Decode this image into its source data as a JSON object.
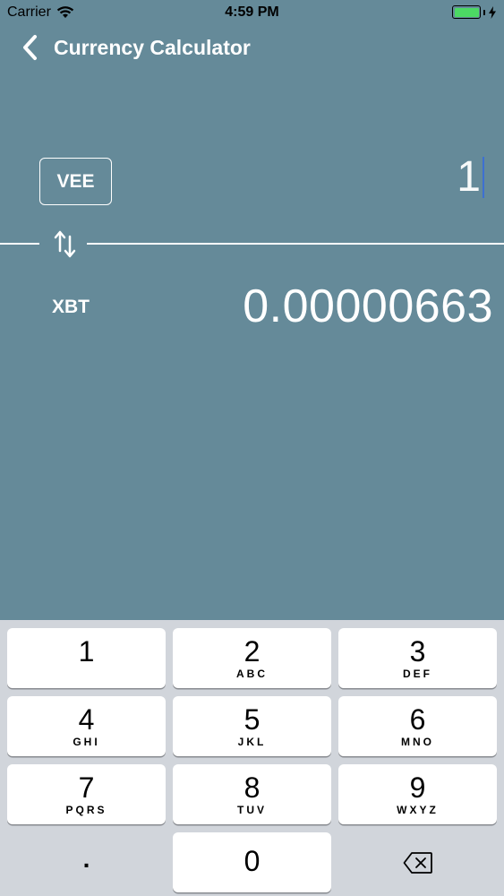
{
  "status_bar": {
    "carrier": "Carrier",
    "time": "4:59 PM",
    "battery_level": 1.0
  },
  "nav": {
    "title": "Currency Calculator"
  },
  "converter": {
    "from_code": "VEE",
    "from_amount": "1",
    "to_code": "XBT",
    "to_amount": "0.00000663"
  },
  "keypad": {
    "keys": [
      {
        "digit": "1",
        "letters": ""
      },
      {
        "digit": "2",
        "letters": "ABC"
      },
      {
        "digit": "3",
        "letters": "DEF"
      },
      {
        "digit": "4",
        "letters": "GHI"
      },
      {
        "digit": "5",
        "letters": "JKL"
      },
      {
        "digit": "6",
        "letters": "MNO"
      },
      {
        "digit": "7",
        "letters": "PQRS"
      },
      {
        "digit": "8",
        "letters": "TUV"
      },
      {
        "digit": "9",
        "letters": "WXYZ"
      },
      {
        "digit": "0",
        "letters": ""
      }
    ],
    "decimal": ".",
    "delete_icon": "backspace-icon"
  },
  "colors": {
    "background": "#658a99",
    "keypad_background": "#d1d5db",
    "battery": "#4cd964",
    "caret": "#3b6fd6"
  }
}
